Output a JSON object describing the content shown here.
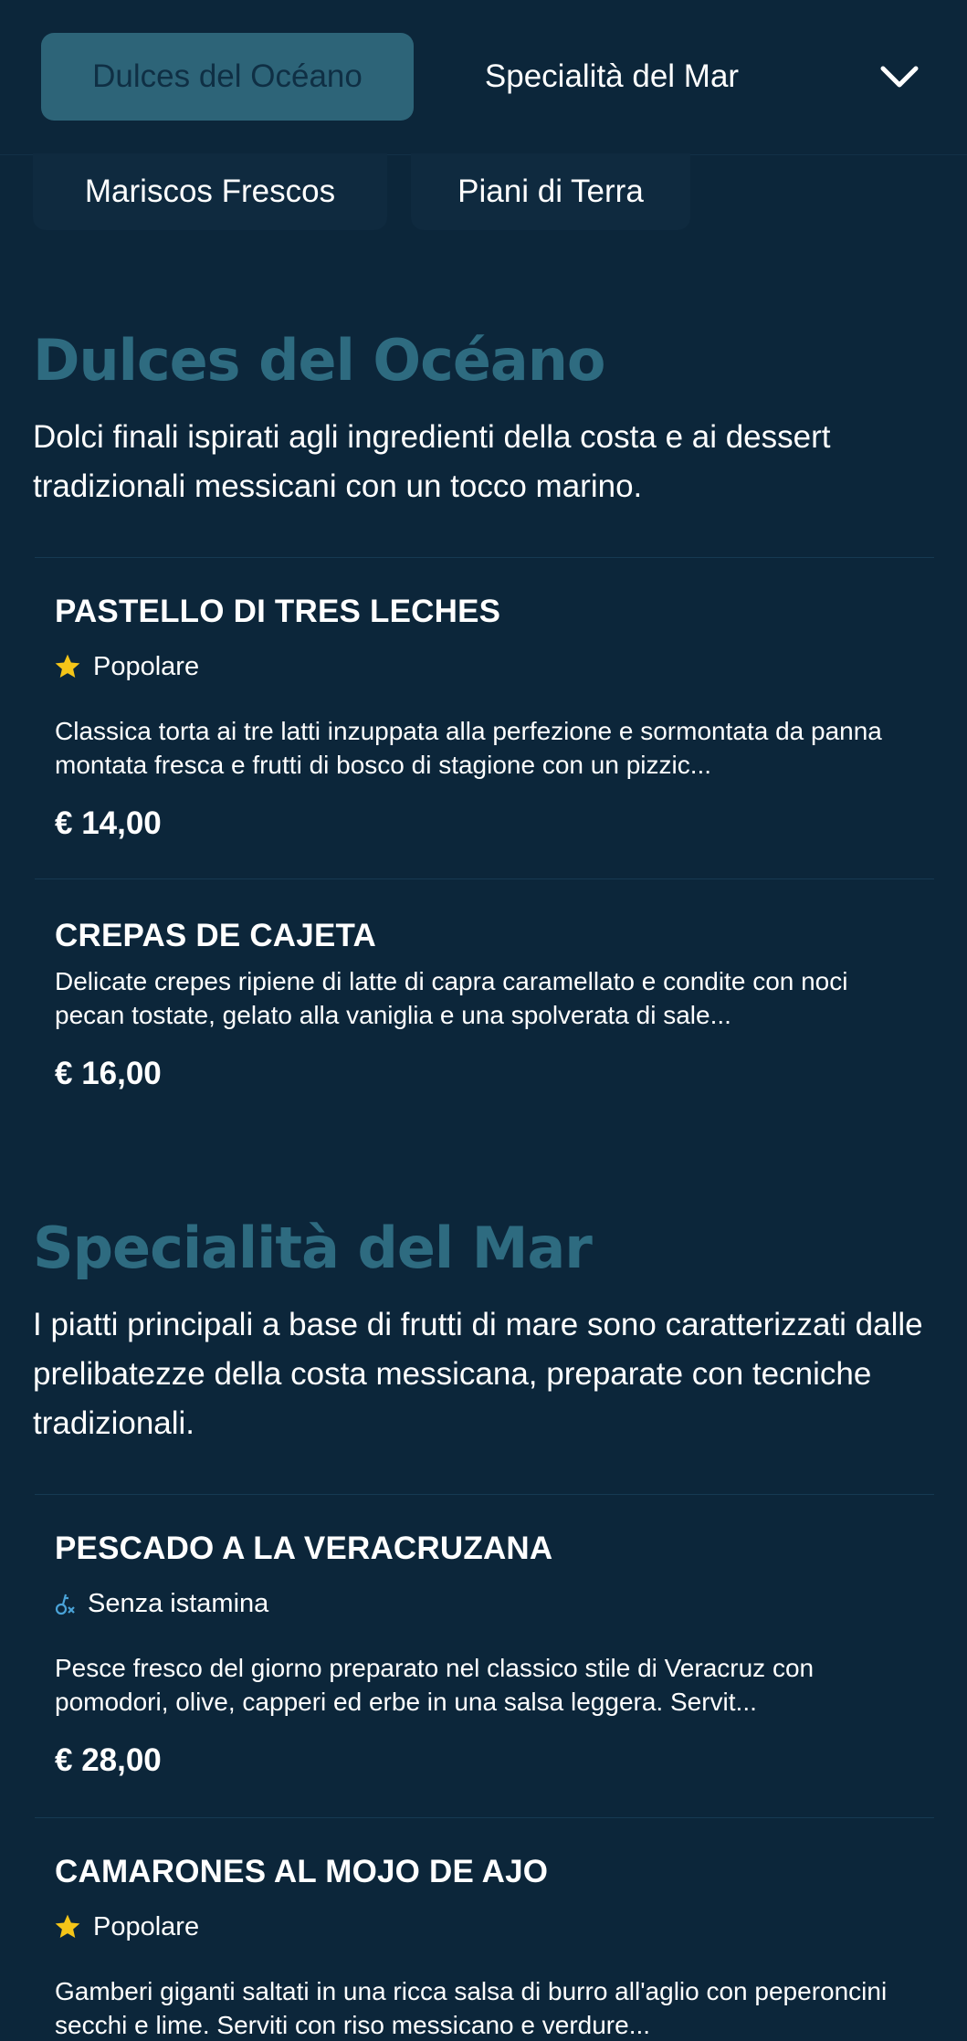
{
  "nav": {
    "tabs": [
      {
        "label": "Dulces del Océano",
        "active": true
      },
      {
        "label": "Specialità del Mar",
        "active": false
      }
    ],
    "more_icon": "chevron-down-icon",
    "chips": [
      {
        "label": "Mariscos Frescos"
      },
      {
        "label": "Piani di Terra"
      }
    ]
  },
  "sections": [
    {
      "title": "Dulces del Océano",
      "description": "Dolci finali ispirati agli ingredienti della costa e ai dessert tradizionali messicani con un tocco marino.",
      "items": [
        {
          "name": "PASTELLO DI TRES LECHES",
          "badge": {
            "icon": "star-icon",
            "label": "Popolare"
          },
          "description": "Classica torta ai tre latti inzuppata alla perfezione e sormontata da panna montata fresca e frutti di bosco di stagione con un pizzic...",
          "price": "€ 14,00"
        },
        {
          "name": "CREPAS DE CAJETA",
          "badge": null,
          "description": "Delicate crepes ripiene di latte di capra caramellato e condite con noci pecan tostate, gelato alla vaniglia e una spolverata di sale...",
          "price": "€ 16,00"
        }
      ]
    },
    {
      "title": "Specialità del Mar",
      "description": "I piatti principali a base di frutti di mare sono caratterizzati dalle prelibatezze della costa messicana, preparate con tecniche tradizionali.",
      "items": [
        {
          "name": "PESCADO A LA VERACRUZANA",
          "badge": {
            "icon": "histamine-free-icon",
            "label": "Senza istamina"
          },
          "description": "Pesce fresco del giorno preparato nel classico stile di Veracruz con pomodori, olive, capperi ed erbe in una salsa leggera. Servit...",
          "price": "€ 28,00"
        },
        {
          "name": "CAMARONES AL MOJO DE AJO",
          "badge": {
            "icon": "star-icon",
            "label": "Popolare"
          },
          "description": "Gamberi giganti saltati in una ricca salsa di burro all'aglio con peperoncini secchi e lime. Serviti con riso messicano e verdure...",
          "price": ""
        }
      ]
    }
  ],
  "colors": {
    "background": "#0c263a",
    "accent": "#2e6b80",
    "active_tab": "#2d6478",
    "star": "#f5c518",
    "histamine_icon": "#4aa3d8"
  }
}
